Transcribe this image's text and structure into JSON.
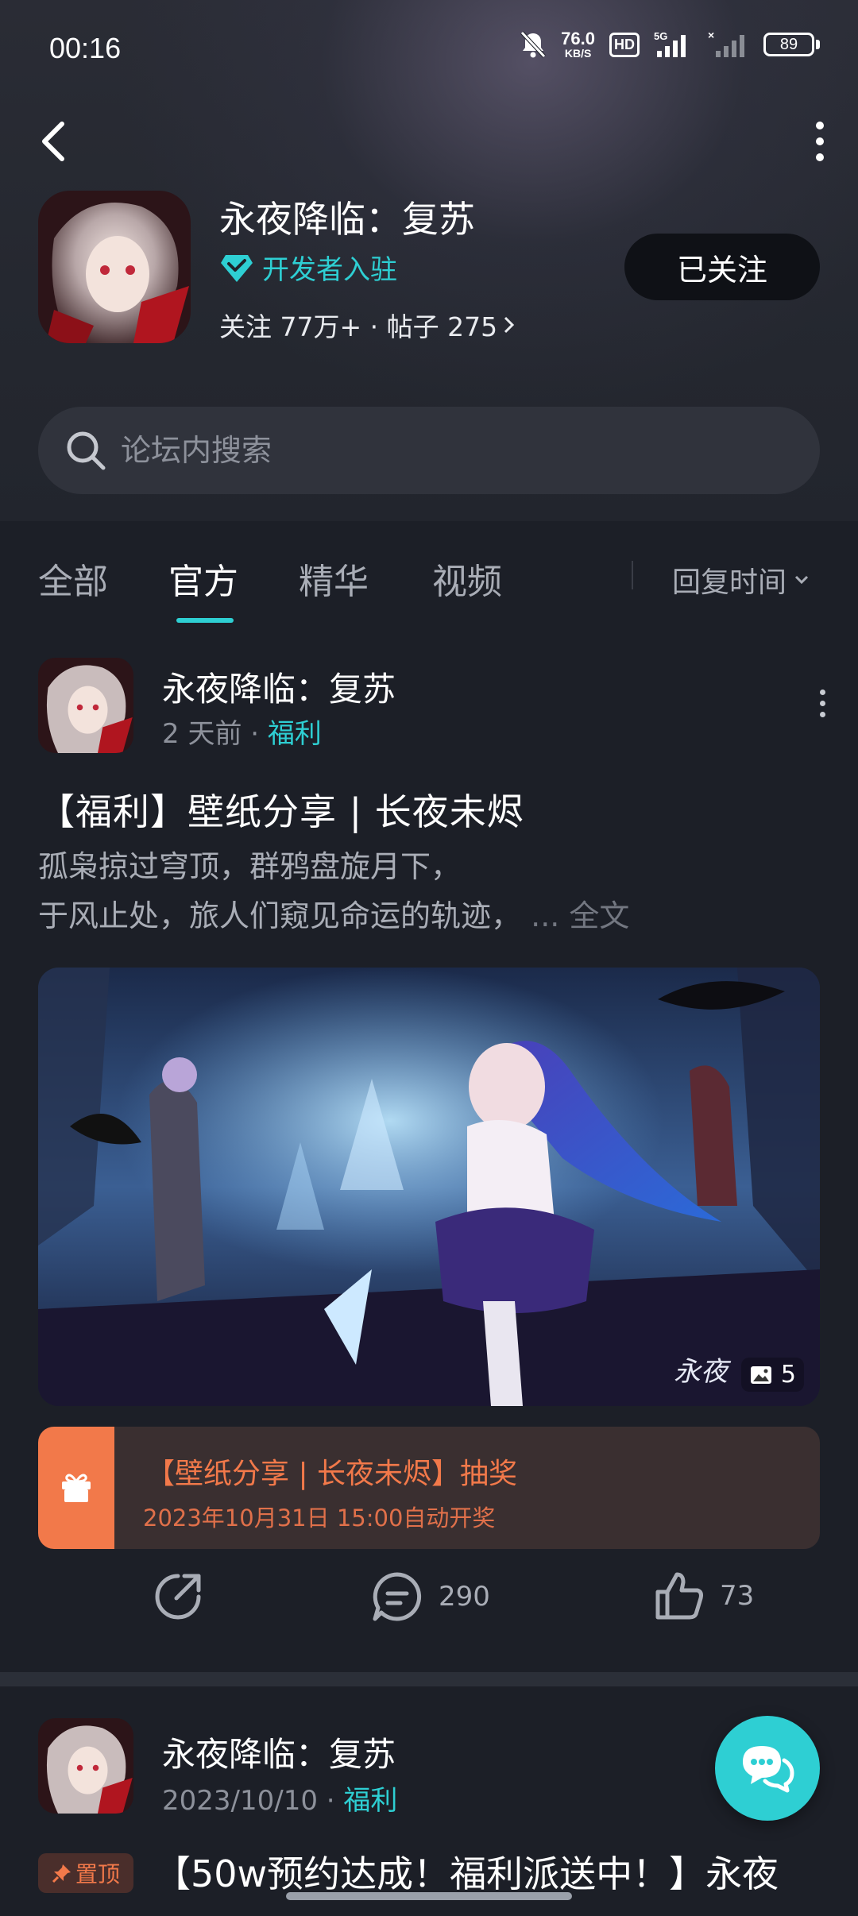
{
  "status_bar": {
    "time": "00:16",
    "net_speed_value": "76.0",
    "net_speed_unit": "KB/S",
    "hd_label": "HD",
    "signal_label": "5G",
    "battery": "89"
  },
  "header": {
    "game_title": "永夜降临：复苏",
    "dev_badge": "开发者入驻",
    "stats": "关注 77万+ · 帖子 275",
    "follow_label": "已关注"
  },
  "search": {
    "placeholder": "论坛内搜索"
  },
  "tabs": {
    "items": [
      {
        "label": "全部"
      },
      {
        "label": "官方"
      },
      {
        "label": "精华"
      },
      {
        "label": "视频"
      }
    ],
    "active": "官方",
    "sort_label": "回复时间"
  },
  "posts": [
    {
      "author": "永夜降临：复苏",
      "time": "2 天前",
      "tag": "福利",
      "title": "【福利】壁纸分享 | 长夜未烬",
      "excerpt_line1": "孤枭掠过穹顶，群鸦盘旋月下，",
      "excerpt_line2": "于风止处，旅人们窥见命运的轨迹，",
      "full_text_link": "... 全文",
      "image_count": "5",
      "lottery_title": "【壁纸分享 | 长夜未烬】抽奖",
      "lottery_time": "2023年10月31日 15:00自动开奖",
      "comments": "290",
      "likes": "73"
    },
    {
      "author": "永夜降临：复苏",
      "time": "2023/10/10",
      "tag": "福利",
      "pin_label": "置顶",
      "title": "【50w预约达成！福利派送中！】永夜"
    }
  ],
  "colors": {
    "accent": "#2ecfd3",
    "lottery_orange": "#f2794a",
    "background": "#1c1f27"
  }
}
